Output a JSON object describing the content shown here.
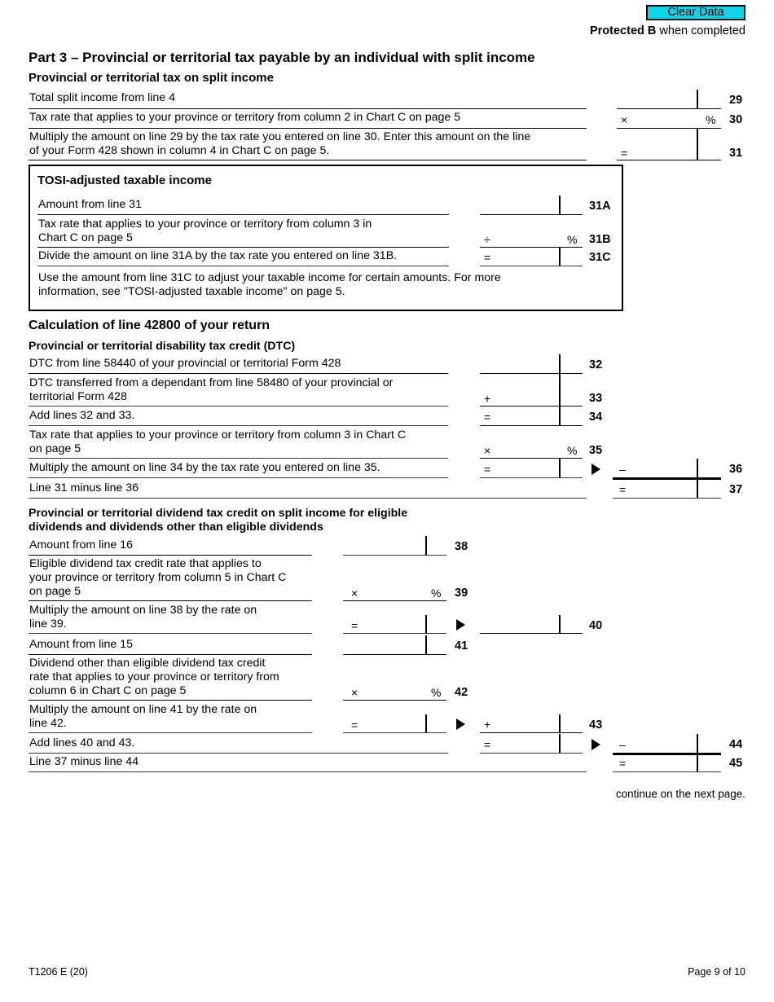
{
  "header": {
    "clear_data_label": "Clear Data",
    "protected_bold": "Protected B",
    "protected_rest": " when completed"
  },
  "headings": {
    "part_title": "Part 3 – Provincial or territorial tax payable by an individual with split income",
    "section_tax_on_split_income": "Provincial or territorial tax on split income",
    "section_calculation": "Calculation of line 42800 of your return",
    "section_dtc": "Provincial or territorial disability tax credit (DTC)",
    "section_dividend_l1": "Provincial or territorial dividend tax credit on split income for eligible",
    "section_dividend_l2": "dividends and dividends other than eligible dividends"
  },
  "tosi_box": {
    "title": "TOSI-adjusted taxable income",
    "note_l1": "Use the amount from line 31C to adjust your taxable income for certain amounts. For more",
    "note_l2": "information, see \"TOSI-adjusted taxable income\" on page 5."
  },
  "lines": {
    "l29": {
      "number": "29",
      "label": "Total split income from line 4",
      "value": "",
      "operator": ""
    },
    "l30": {
      "number": "30",
      "label": "Tax rate that applies to your province or territory from column 2 in Chart C on page 5",
      "value": "",
      "operator": "×",
      "percent": "%"
    },
    "l31": {
      "number": "31",
      "label_l1": "Multiply the amount on line 29 by the tax rate you entered on line 30. Enter this amount on the line",
      "label_l2": "of your Form 428 shown in column 4 in Chart C on page 5.",
      "value": "",
      "operator": "="
    },
    "l31a": {
      "number": "31A",
      "label": "Amount from line 31",
      "value": "",
      "operator": ""
    },
    "l31b": {
      "number": "31B",
      "label_l1": "Tax rate that applies to your province or territory from column 3 in",
      "label_l2": "Chart C on page 5",
      "value": "",
      "operator": "÷",
      "percent": "%"
    },
    "l31c": {
      "number": "31C",
      "label": "Divide the amount on line 31A by the tax rate you entered on line 31B.",
      "value": "",
      "operator": "="
    },
    "l32": {
      "number": "32",
      "label": "DTC from line 58440 of your provincial or territorial Form 428",
      "value": "",
      "operator": ""
    },
    "l33": {
      "number": "33",
      "label_l1": "DTC transferred from a dependant from line 58480 of your provincial or",
      "label_l2": "territorial Form 428",
      "value": "",
      "operator": "+"
    },
    "l34": {
      "number": "34",
      "label": "Add lines 32 and 33.",
      "value": "",
      "operator": "="
    },
    "l35": {
      "number": "35",
      "label_l1": "Tax rate that applies to your province or territory from column 3 in Chart C",
      "label_l2": "on page 5",
      "value": "",
      "operator": "×",
      "percent": "%"
    },
    "l36": {
      "number": "36",
      "label": "Multiply the amount on line 34 by the tax rate you entered on line 35.",
      "value": "",
      "operator": "=",
      "carry_operator": "–",
      "carry_value": ""
    },
    "l37": {
      "number": "37",
      "label": "Line 31 minus line 36",
      "value": "",
      "operator": "="
    },
    "l38": {
      "number": "38",
      "label": "Amount from line 16",
      "value": "",
      "operator": ""
    },
    "l39": {
      "number": "39",
      "label_l1": "Eligible dividend tax credit rate that applies to",
      "label_l2": "your province or territory from column 5 in Chart C",
      "label_l3": "on page 5",
      "value": "",
      "operator": "×",
      "percent": "%"
    },
    "l40": {
      "number": "40",
      "label_l1": "Multiply the amount on line 38 by the rate on",
      "label_l2": "line 39.",
      "value": "",
      "operator": "=",
      "carry_value": ""
    },
    "l41": {
      "number": "41",
      "label": "Amount from line 15",
      "value": "",
      "operator": ""
    },
    "l42": {
      "number": "42",
      "label_l1": "Dividend other than eligible dividend tax credit",
      "label_l2": "rate that applies to your province or territory from",
      "label_l3": "column 6 in Chart C on page 5",
      "value": "",
      "operator": "×",
      "percent": "%"
    },
    "l43": {
      "number": "43",
      "label_l1": "Multiply the amount on line 41 by the rate on",
      "label_l2": "line 42.",
      "value": "",
      "operator": "=",
      "carry_operator": "+",
      "carry_value": ""
    },
    "l44": {
      "number": "44",
      "label": "Add lines 40 and 43.",
      "value": "",
      "operator": "=",
      "carry_operator": "–",
      "carry_value": ""
    },
    "l45": {
      "number": "45",
      "label": "Line 37 minus line 44",
      "value": "",
      "operator": "="
    }
  },
  "footer": {
    "continue_note": "continue on the next page.",
    "form_code": "T1206 E (20)",
    "page_number": "Page 9 of 10"
  }
}
